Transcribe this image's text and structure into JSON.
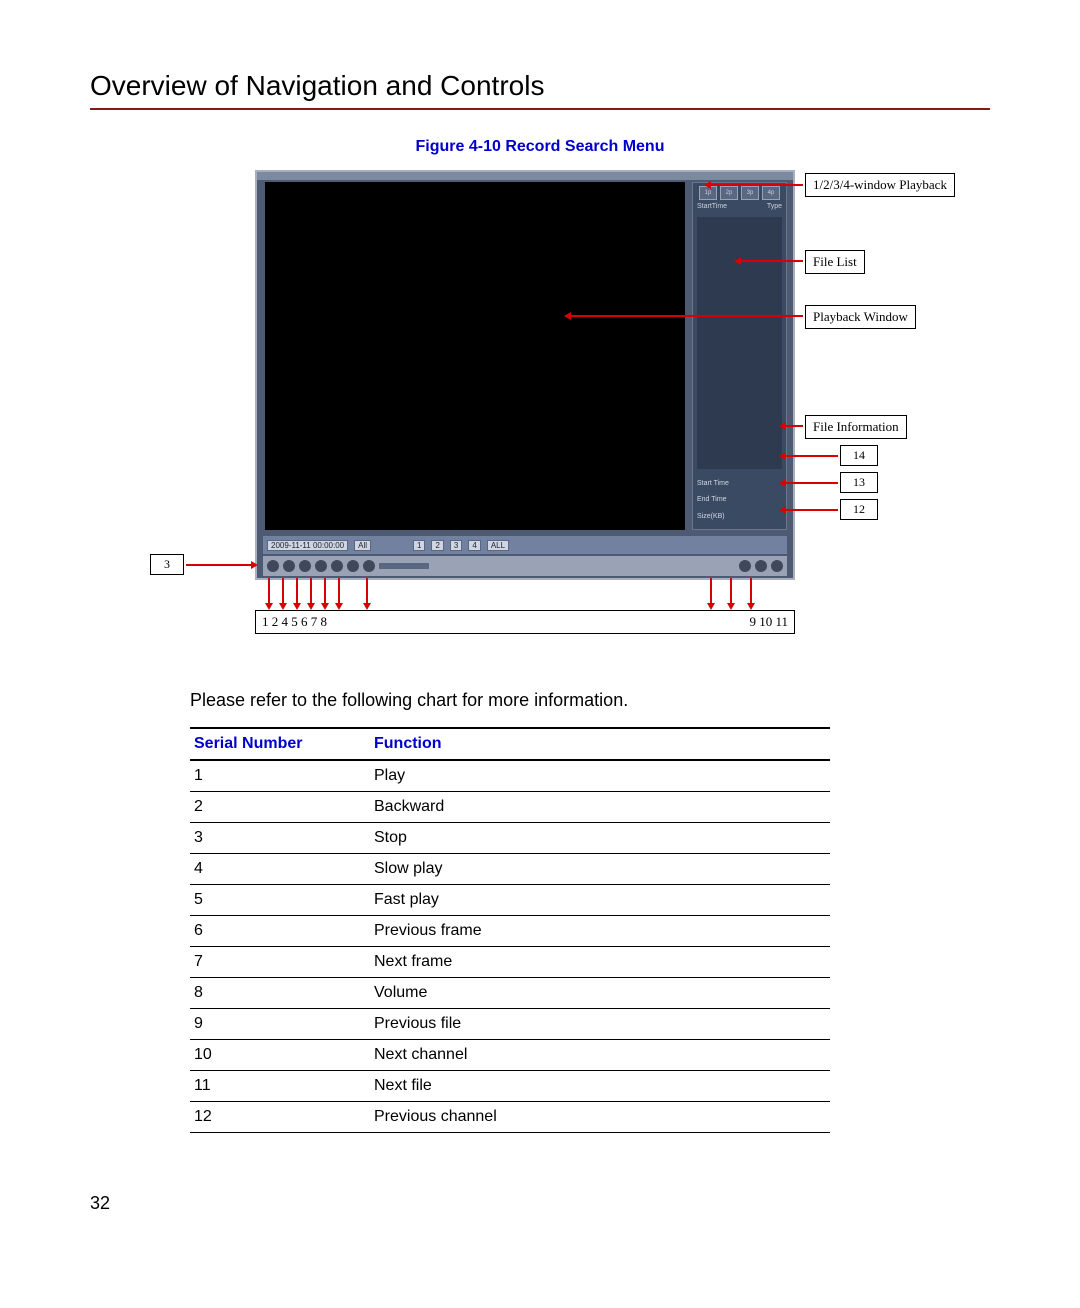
{
  "section_title": "Overview of Navigation and Controls",
  "figure_caption": "Figure 4-10 Record Search Menu",
  "player": {
    "timestamp": "2009-11-11 00:00:00",
    "win_buttons": [
      "1p",
      "2p",
      "3p",
      "4p"
    ],
    "side_header_left": "StartTime",
    "side_header_right": "Type",
    "info_rows": [
      {
        "label": "Start Time",
        "value": ""
      },
      {
        "label": "End Time",
        "value": ""
      },
      {
        "label": "Size(KB)",
        "value": ""
      }
    ],
    "status_all": "All",
    "status_filters": [
      "1",
      "2",
      "3",
      "4",
      "ALL"
    ]
  },
  "callouts": {
    "playback_windows": "1/2/3/4-window Playback",
    "file_list": "File List",
    "playback_window": "Playback Window",
    "file_information": "File Information",
    "n14": "14",
    "n13": "13",
    "n12": "12",
    "n3": "3"
  },
  "bottom_numbers_left": "1 2 4 5 6 7    8",
  "bottom_numbers_right": "9 10 11",
  "chart_intro": "Please refer to the following chart for more information.",
  "table": {
    "headers": {
      "serial": "Serial Number",
      "function": "Function"
    },
    "rows": [
      {
        "n": "1",
        "f": "Play"
      },
      {
        "n": "2",
        "f": "Backward"
      },
      {
        "n": "3",
        "f": "Stop"
      },
      {
        "n": "4",
        "f": "Slow play"
      },
      {
        "n": "5",
        "f": "Fast play"
      },
      {
        "n": "6",
        "f": "Previous frame"
      },
      {
        "n": "7",
        "f": "Next frame"
      },
      {
        "n": "8",
        "f": "Volume"
      },
      {
        "n": "9",
        "f": "Previous file"
      },
      {
        "n": "10",
        "f": "Next channel"
      },
      {
        "n": "11",
        "f": "Next file"
      },
      {
        "n": "12",
        "f": "Previous channel"
      }
    ]
  },
  "page_number": "32"
}
